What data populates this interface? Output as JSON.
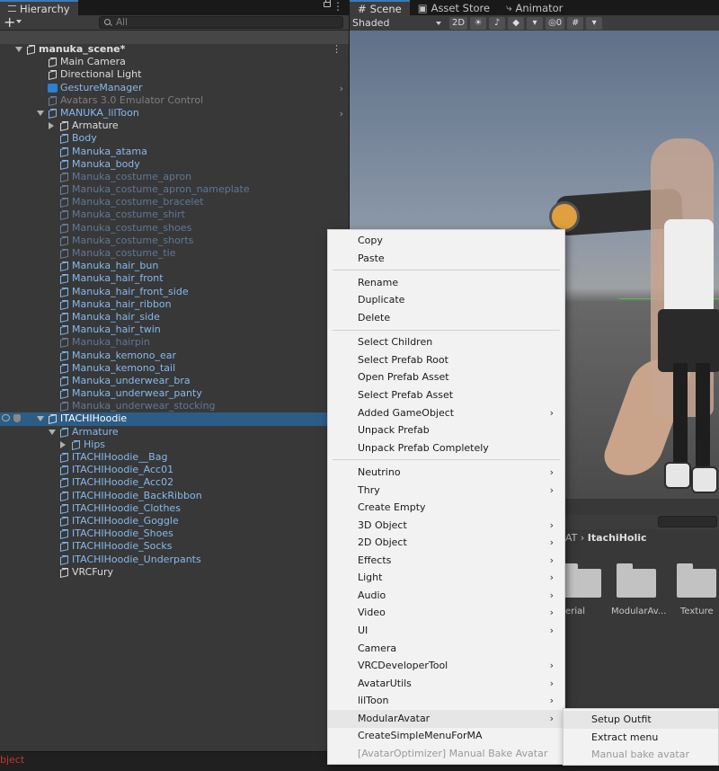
{
  "hierarchy": {
    "tab_label": "Hierarchy",
    "search_placeholder": "All",
    "add_label": "+",
    "rows": [
      {
        "label": "manuka_scene*",
        "depth": 0,
        "style": "bold",
        "fold": "open",
        "icon": "scene-icon",
        "kebab": true
      },
      {
        "label": "Main Camera",
        "depth": 1,
        "style": "white",
        "icon": "cube-icon"
      },
      {
        "label": "Directional Light",
        "depth": 1,
        "style": "white",
        "icon": "cube-icon"
      },
      {
        "label": "GestureManager",
        "depth": 1,
        "style": "blue",
        "icon": "gesture-manager-icon",
        "arrow": true
      },
      {
        "label": "Avatars 3.0 Emulator Control",
        "depth": 1,
        "style": "gray",
        "icon": "cube-icon"
      },
      {
        "label": "MANUKA_lilToon",
        "depth": 1,
        "style": "blue",
        "fold": "open",
        "icon": "prefab-icon",
        "arrow": true
      },
      {
        "label": "Armature",
        "depth": 2,
        "style": "white",
        "fold": "closed",
        "icon": "cube-icon"
      },
      {
        "label": "Body",
        "depth": 2,
        "style": "blue",
        "icon": "cube-icon"
      },
      {
        "label": "Manuka_atama",
        "depth": 2,
        "style": "blue",
        "icon": "cube-icon"
      },
      {
        "label": "Manuka_body",
        "depth": 2,
        "style": "blue",
        "icon": "cube-icon"
      },
      {
        "label": "Manuka_costume_apron",
        "depth": 2,
        "style": "faded",
        "icon": "cube-icon"
      },
      {
        "label": "Manuka_costume_apron_nameplate",
        "depth": 2,
        "style": "faded",
        "icon": "cube-icon"
      },
      {
        "label": "Manuka_costume_bracelet",
        "depth": 2,
        "style": "faded",
        "icon": "cube-icon"
      },
      {
        "label": "Manuka_costume_shirt",
        "depth": 2,
        "style": "faded",
        "icon": "cube-icon"
      },
      {
        "label": "Manuka_costume_shoes",
        "depth": 2,
        "style": "faded",
        "icon": "cube-icon"
      },
      {
        "label": "Manuka_costume_shorts",
        "depth": 2,
        "style": "faded",
        "icon": "cube-icon"
      },
      {
        "label": "Manuka_costume_tie",
        "depth": 2,
        "style": "faded",
        "icon": "cube-icon"
      },
      {
        "label": "Manuka_hair_bun",
        "depth": 2,
        "style": "blue",
        "icon": "cube-icon"
      },
      {
        "label": "Manuka_hair_front",
        "depth": 2,
        "style": "blue",
        "icon": "cube-icon"
      },
      {
        "label": "Manuka_hair_front_side",
        "depth": 2,
        "style": "blue",
        "icon": "cube-icon"
      },
      {
        "label": "Manuka_hair_ribbon",
        "depth": 2,
        "style": "blue",
        "icon": "cube-icon"
      },
      {
        "label": "Manuka_hair_side",
        "depth": 2,
        "style": "blue",
        "icon": "cube-icon"
      },
      {
        "label": "Manuka_hair_twin",
        "depth": 2,
        "style": "blue",
        "icon": "cube-icon"
      },
      {
        "label": "Manuka_hairpin",
        "depth": 2,
        "style": "faded",
        "icon": "cube-icon"
      },
      {
        "label": "Manuka_kemono_ear",
        "depth": 2,
        "style": "blue",
        "icon": "cube-icon"
      },
      {
        "label": "Manuka_kemono_tail",
        "depth": 2,
        "style": "blue",
        "icon": "cube-icon"
      },
      {
        "label": "Manuka_underwear_bra",
        "depth": 2,
        "style": "blue",
        "icon": "cube-icon"
      },
      {
        "label": "Manuka_underwear_panty",
        "depth": 2,
        "style": "blue",
        "icon": "cube-icon"
      },
      {
        "label": "Manuka_underwear_stocking",
        "depth": 2,
        "style": "faded",
        "icon": "cube-icon"
      },
      {
        "label": "ITACHIHoodie",
        "depth": 1,
        "style": "white",
        "fold": "open",
        "icon": "cube-icon",
        "selected": true
      },
      {
        "label": "Armature",
        "depth": 2,
        "style": "blue",
        "fold": "open",
        "icon": "cube-icon"
      },
      {
        "label": "Hips",
        "depth": 3,
        "style": "blue",
        "fold": "closed",
        "icon": "cube-icon"
      },
      {
        "label": "ITACHIHoodie__Bag",
        "depth": 2,
        "style": "blue",
        "icon": "cube-icon"
      },
      {
        "label": "ITACHIHoodie_Acc01",
        "depth": 2,
        "style": "blue",
        "icon": "cube-icon"
      },
      {
        "label": "ITACHIHoodie_Acc02",
        "depth": 2,
        "style": "blue",
        "icon": "cube-icon"
      },
      {
        "label": "ITACHIHoodie_BackRibbon",
        "depth": 2,
        "style": "blue",
        "icon": "cube-icon"
      },
      {
        "label": "ITACHIHoodie_Clothes",
        "depth": 2,
        "style": "blue",
        "icon": "cube-icon"
      },
      {
        "label": "ITACHIHoodie_Goggle",
        "depth": 2,
        "style": "blue",
        "icon": "cube-icon"
      },
      {
        "label": "ITACHIHoodie_Shoes",
        "depth": 2,
        "style": "blue",
        "icon": "cube-icon"
      },
      {
        "label": "ITACHIHoodie_Socks",
        "depth": 2,
        "style": "blue",
        "icon": "cube-icon"
      },
      {
        "label": "ITACHIHoodie_Underpants",
        "depth": 2,
        "style": "blue",
        "icon": "cube-icon"
      },
      {
        "label": "VRCFury",
        "depth": 2,
        "style": "white",
        "icon": "cube-icon"
      }
    ]
  },
  "scene": {
    "tabs": [
      {
        "label": "Scene",
        "icon": "grid-icon",
        "active": true
      },
      {
        "label": "Asset Store",
        "icon": "bag-icon",
        "active": false
      },
      {
        "label": "Animator",
        "icon": "animator-icon",
        "active": false
      }
    ],
    "shading_mode": "Shaded",
    "mode_2d": "2D",
    "hidden_count": "0"
  },
  "project": {
    "breadcrumb_prefix": "AT",
    "breadcrumb_current": "ItachiHolic",
    "folders": [
      "aterial",
      "ModularAv...",
      "Texture"
    ]
  },
  "context_menu": {
    "groups": [
      [
        {
          "label": "Copy"
        },
        {
          "label": "Paste"
        }
      ],
      [
        {
          "label": "Rename"
        },
        {
          "label": "Duplicate"
        },
        {
          "label": "Delete"
        }
      ],
      [
        {
          "label": "Select Children"
        },
        {
          "label": "Select Prefab Root"
        },
        {
          "label": "Open Prefab Asset"
        },
        {
          "label": "Select Prefab Asset"
        },
        {
          "label": "Added GameObject",
          "sub": true
        },
        {
          "label": "Unpack Prefab"
        },
        {
          "label": "Unpack Prefab Completely"
        }
      ],
      [
        {
          "label": "Neutrino",
          "sub": true
        },
        {
          "label": "Thry",
          "sub": true
        },
        {
          "label": "Create Empty"
        },
        {
          "label": "3D Object",
          "sub": true
        },
        {
          "label": "2D Object",
          "sub": true
        },
        {
          "label": "Effects",
          "sub": true
        },
        {
          "label": "Light",
          "sub": true
        },
        {
          "label": "Audio",
          "sub": true
        },
        {
          "label": "Video",
          "sub": true
        },
        {
          "label": "UI",
          "sub": true
        },
        {
          "label": "Camera"
        },
        {
          "label": "VRCDeveloperTool",
          "sub": true
        },
        {
          "label": "AvatarUtils",
          "sub": true
        },
        {
          "label": "lilToon",
          "sub": true
        },
        {
          "label": "ModularAvatar",
          "sub": true,
          "highlighted": true
        },
        {
          "label": "CreateSimpleMenuForMA"
        },
        {
          "label": "[AvatarOptimizer] Manual Bake Avatar",
          "disabled": true
        }
      ]
    ]
  },
  "submenu": {
    "items": [
      {
        "label": "Setup Outfit",
        "highlighted": true
      },
      {
        "label": "Extract menu"
      },
      {
        "label": "Manual bake avatar",
        "disabled": true
      }
    ]
  },
  "status": {
    "text": "bject"
  },
  "colors": {
    "selection": "#2c5d87",
    "accent_tab": "#3a79bb",
    "prefab_text": "#86b9ee",
    "error_text": "#c0392b"
  }
}
